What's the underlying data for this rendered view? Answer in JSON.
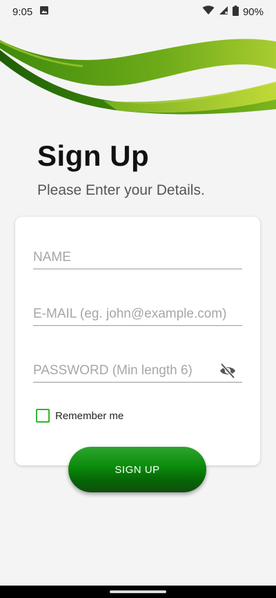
{
  "status": {
    "time": "9:05",
    "battery": "90%",
    "icons": [
      "image-icon",
      "wifi-icon",
      "signal-icon",
      "battery-icon"
    ]
  },
  "header": {
    "title": "Sign Up",
    "subtitle": "Please Enter your Details."
  },
  "form": {
    "name_placeholder": "NAME",
    "email_placeholder": "E-MAIL (eg. john@example.com)",
    "password_placeholder": "PASSWORD (Min length 6)",
    "remember_label": "Remember me",
    "remember_checked": false
  },
  "actions": {
    "signup_label": "SIGN UP"
  },
  "colors": {
    "accent": "#0a8a0a",
    "wave_light": "#9dc32a",
    "wave_dark": "#2d7a08",
    "checkbox": "#2fb52f"
  }
}
